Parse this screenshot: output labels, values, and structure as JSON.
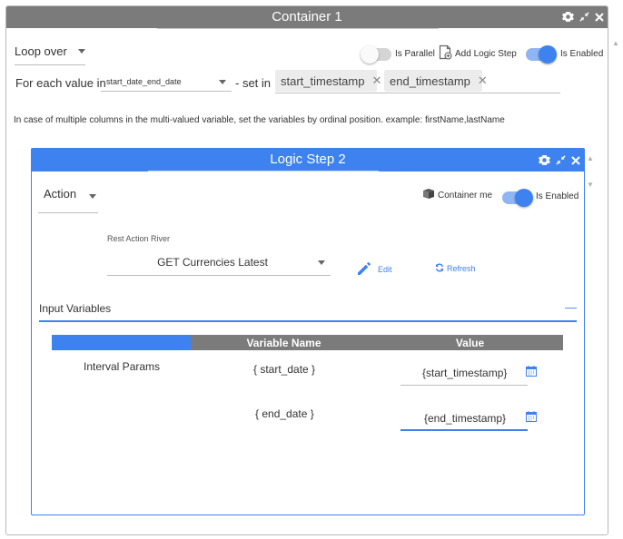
{
  "container": {
    "title": "Container 1",
    "loop_label": "Loop over",
    "for_each_label": "For each value in",
    "variable_value": "start_date_end_date",
    "set_in_label": "- set in",
    "chips": [
      "start_timestamp",
      "end_timestamp"
    ],
    "is_parallel_label": "Is Parallel",
    "add_logic_step_label": "Add Logic Step",
    "is_enabled_label": "Is Enabled",
    "info_text": "In case of multiple columns in the multi-valued variable, set the variables by ordinal position. example: firstName,lastName",
    "is_parallel_on": false,
    "is_enabled_on": true
  },
  "logic_step": {
    "title": "Logic Step 2",
    "action_label": "Action",
    "container_me_label": "Container me",
    "is_enabled_label": "Is Enabled",
    "is_enabled_on": true,
    "river_label": "Rest Action River",
    "river_value": "GET Currencies Latest",
    "edit_label": "Edit",
    "refresh_label": "Refresh",
    "input_variables_label": "Input Variables",
    "collapse_glyph": "—",
    "table": {
      "headers": [
        "Variable Name",
        "Value"
      ],
      "group_label": "Interval Params",
      "rows": [
        {
          "name": "{ start_date }",
          "value": "{start_timestamp}"
        },
        {
          "name": "{ end_date }",
          "value": "{end_timestamp}"
        }
      ]
    }
  },
  "colors": {
    "accent": "#3e82f0",
    "header_gray": "#7b7b7b"
  }
}
